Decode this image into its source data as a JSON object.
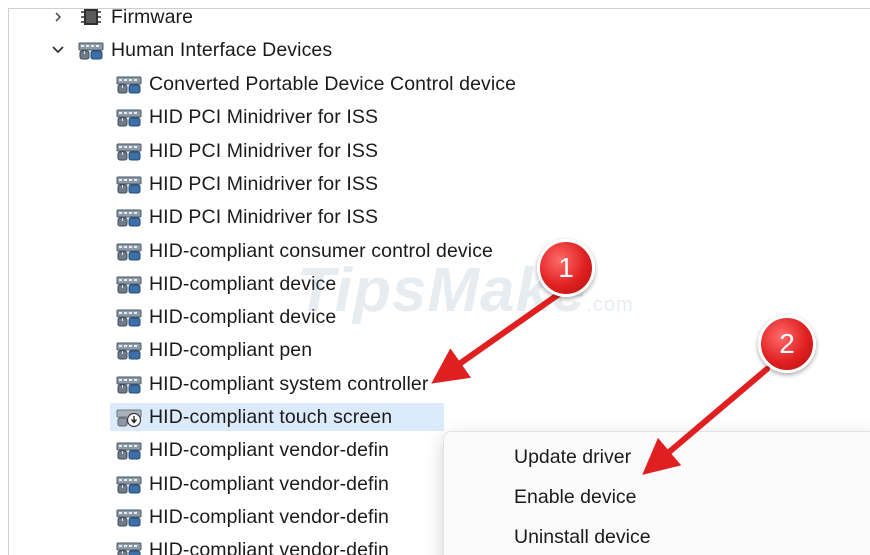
{
  "tree": {
    "firmware": {
      "label": "Firmware",
      "icon": "firmware-chip-icon",
      "expanded": false
    },
    "hid_category": {
      "label": "Human Interface Devices",
      "icon": "hid-device-icon",
      "expanded": true
    },
    "devices": [
      {
        "label": "Converted Portable Device Control device",
        "icon": "hid-device-icon",
        "disabled": false
      },
      {
        "label": "HID PCI Minidriver for ISS",
        "icon": "hid-device-icon",
        "disabled": false
      },
      {
        "label": "HID PCI Minidriver for ISS",
        "icon": "hid-device-icon",
        "disabled": false
      },
      {
        "label": "HID PCI Minidriver for ISS",
        "icon": "hid-device-icon",
        "disabled": false
      },
      {
        "label": "HID PCI Minidriver for ISS",
        "icon": "hid-device-icon",
        "disabled": false
      },
      {
        "label": "HID-compliant consumer control device",
        "icon": "hid-device-icon",
        "disabled": false
      },
      {
        "label": "HID-compliant device",
        "icon": "hid-device-icon",
        "disabled": false
      },
      {
        "label": "HID-compliant device",
        "icon": "hid-device-icon",
        "disabled": false
      },
      {
        "label": "HID-compliant pen",
        "icon": "hid-device-icon",
        "disabled": false
      },
      {
        "label": "HID-compliant system controller",
        "icon": "hid-device-icon",
        "disabled": false
      },
      {
        "label": "HID-compliant touch screen",
        "icon": "disabled-device-icon",
        "disabled": true,
        "selected": true
      },
      {
        "label": "HID-compliant vendor-defin",
        "icon": "hid-device-icon",
        "disabled": false
      },
      {
        "label": "HID-compliant vendor-defin",
        "icon": "hid-device-icon",
        "disabled": false
      },
      {
        "label": "HID-compliant vendor-defin",
        "icon": "hid-device-icon",
        "disabled": false
      },
      {
        "label": "HID-compliant vendor-defin",
        "icon": "hid-device-icon",
        "disabled": false
      }
    ]
  },
  "context_menu": {
    "items": [
      {
        "label": "Update driver"
      },
      {
        "label": "Enable device"
      },
      {
        "label": "Uninstall device"
      }
    ]
  },
  "annotations": {
    "badge_1": "1",
    "badge_2": "2",
    "arrow_color": "#e02020"
  },
  "watermark": {
    "main": "TipsMake",
    "suffix": ".com"
  },
  "colors": {
    "selection": "#dcebfb",
    "text": "#1b1b1b"
  }
}
